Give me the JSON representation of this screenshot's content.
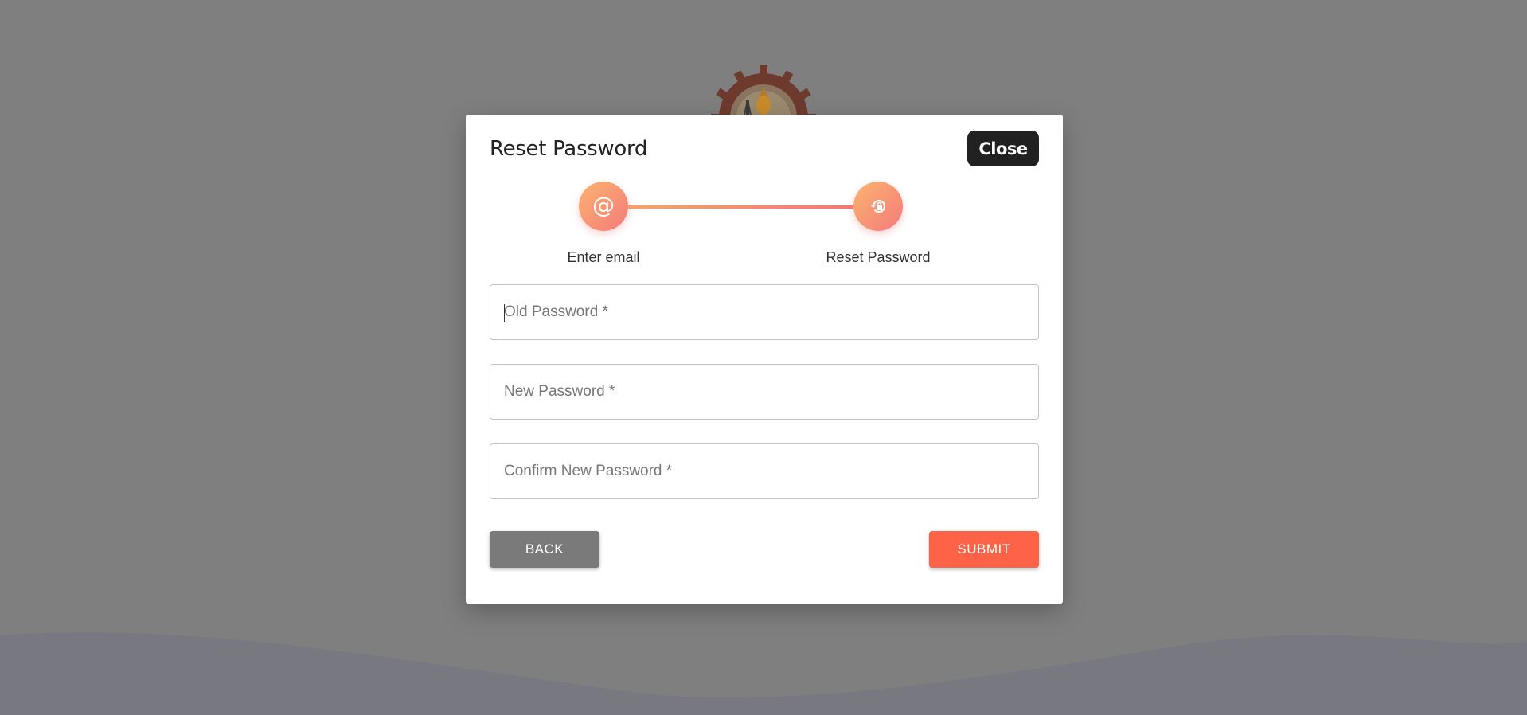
{
  "dialog": {
    "title": "Reset Password",
    "close_label": "Close"
  },
  "stepper": {
    "steps": [
      {
        "label": "Enter email",
        "icon": "at-sign-icon"
      },
      {
        "label": "Reset Password",
        "icon": "lock-reset-icon"
      }
    ],
    "active_step": 2,
    "gradient_colors": [
      "#fcb36f",
      "#f47b7b"
    ]
  },
  "form": {
    "old_password": {
      "placeholder": "Old Password *",
      "value": ""
    },
    "new_password": {
      "placeholder": "New Password *",
      "value": ""
    },
    "confirm_password": {
      "placeholder": "Confirm New Password *",
      "value": ""
    }
  },
  "actions": {
    "back_label": "BACK",
    "submit_label": "SUBMIT"
  },
  "colors": {
    "overlay": "#7f7f7f",
    "submit": "#ff6347",
    "back": "#7a7a7a",
    "close": "#212121"
  }
}
